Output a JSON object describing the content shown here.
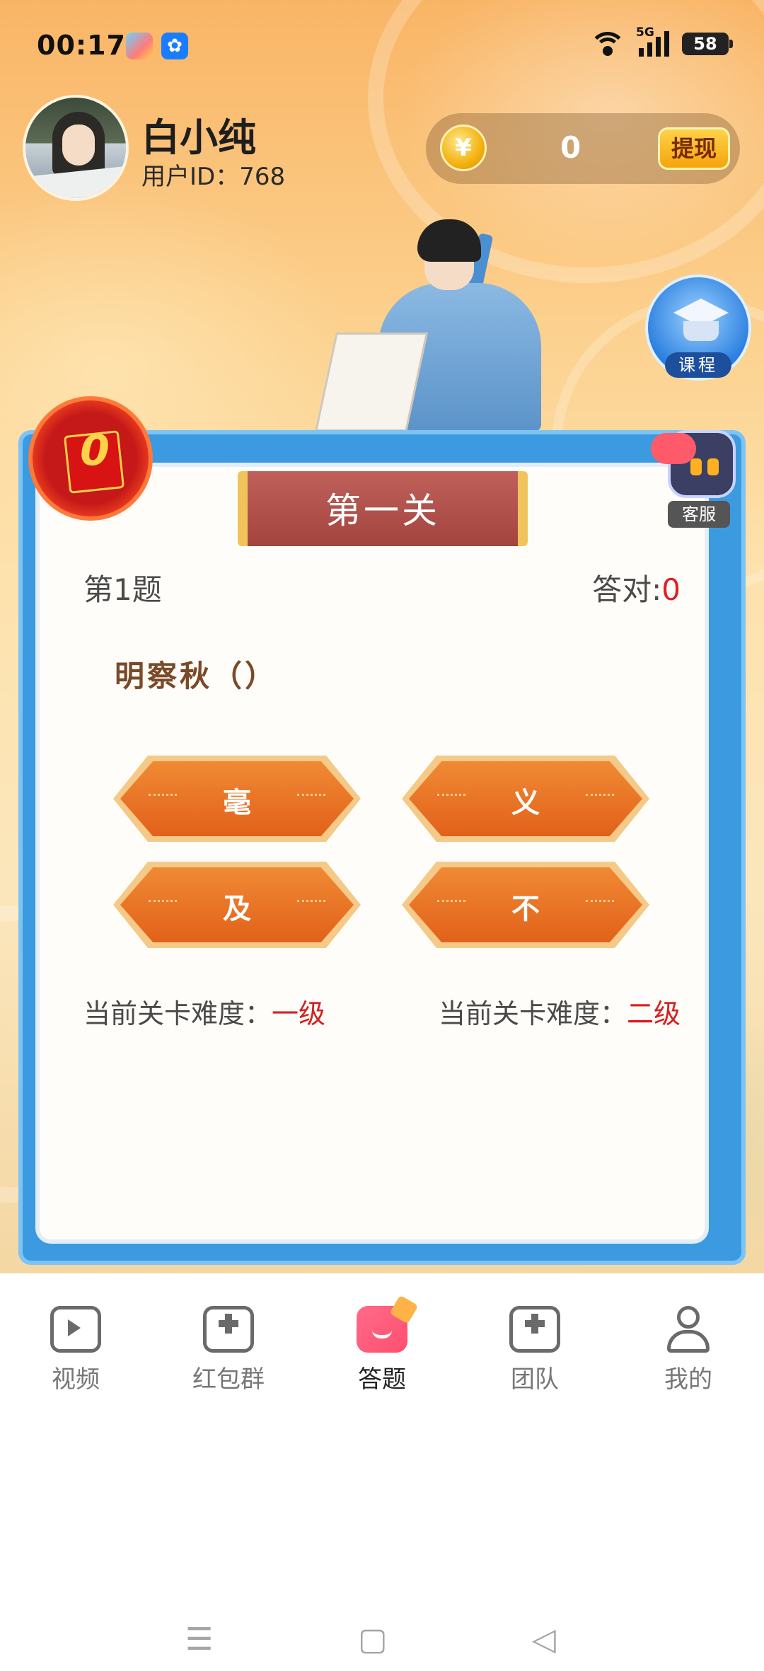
{
  "status": {
    "time": "00:17",
    "network": "5G",
    "battery": "58"
  },
  "profile": {
    "name": "白小纯",
    "user_id": "用户ID：768"
  },
  "wallet": {
    "coin_symbol": "¥",
    "balance": "0",
    "withdraw_label": "提现"
  },
  "side": {
    "course_label": "课程",
    "service_label": "客服",
    "red_packet_count": "0"
  },
  "quiz": {
    "level_title": "第一关",
    "question_index": "第1题",
    "correct_label": "答对:",
    "correct_count": "0",
    "question": "明察秋（）",
    "options": [
      "毫",
      "义",
      "及",
      "不"
    ],
    "difficulty_left_label": "当前关卡难度：",
    "difficulty_left_value": "一级",
    "difficulty_right_label": "当前关卡难度：",
    "difficulty_right_value": "二级"
  },
  "nav": {
    "items": [
      {
        "label": "视频",
        "icon": "video-icon"
      },
      {
        "label": "红包群",
        "icon": "inbox-plus-icon"
      },
      {
        "label": "答题",
        "icon": "quiz-icon",
        "active": true
      },
      {
        "label": "团队",
        "icon": "inbox-plus-icon"
      },
      {
        "label": "我的",
        "icon": "user-icon"
      }
    ]
  },
  "system_nav": {
    "menu": "☰",
    "home": "▢",
    "back": "◁"
  }
}
